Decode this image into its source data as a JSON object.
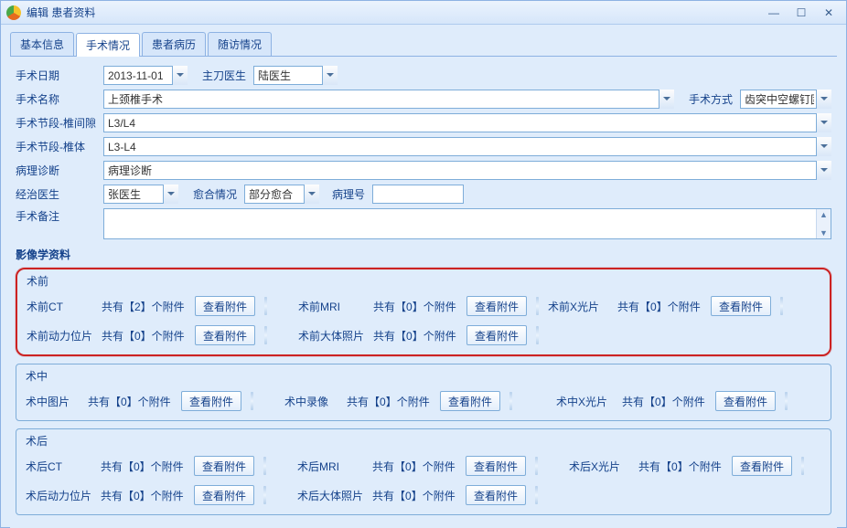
{
  "window": {
    "title": "编辑 患者资料"
  },
  "tabs": {
    "t0": "基本信息",
    "t1": "手术情况",
    "t2": "患者病历",
    "t3": "随访情况"
  },
  "form": {
    "date_label": "手术日期",
    "date_value": "2013-11-01",
    "surgeon_label": "主刀医生",
    "surgeon_value": "陆医生",
    "name_label": "手术名称",
    "name_value": "上颈椎手术",
    "method_label": "手术方式",
    "method_value": "齿突中空螺钉固定",
    "seg_gap_label": "手术节段-椎间隙",
    "seg_gap_value": "L3/L4",
    "seg_body_label": "手术节段-椎体",
    "seg_body_value": "L3-L4",
    "path_label": "病理诊断",
    "path_value": "病理诊断",
    "attending_label": "经治医生",
    "attending_value": "张医生",
    "healing_label": "愈合情况",
    "healing_value": "部分愈合",
    "pathno_label": "病理号",
    "pathno_value": "",
    "notes_label": "手术备注",
    "notes_value": ""
  },
  "imaging_heading": "影像学资料",
  "labels": {
    "view_attach": "查看附件",
    "count_prefix": "共有【",
    "count_suffix": "】个附件"
  },
  "groups": {
    "pre": {
      "title": "术前",
      "ct": {
        "label": "术前CT",
        "count": 2
      },
      "mri": {
        "label": "术前MRI",
        "count": 0
      },
      "xray": {
        "label": "术前X光片",
        "count": 0
      },
      "dyn": {
        "label": "术前动力位片",
        "count": 0
      },
      "gross": {
        "label": "术前大体照片",
        "count": 0
      }
    },
    "intra": {
      "title": "术中",
      "pic": {
        "label": "术中图片",
        "count": 0
      },
      "video": {
        "label": "术中录像",
        "count": 0
      },
      "xray": {
        "label": "术中X光片",
        "count": 0
      }
    },
    "post": {
      "title": "术后",
      "ct": {
        "label": "术后CT",
        "count": 0
      },
      "mri": {
        "label": "术后MRI",
        "count": 0
      },
      "xray": {
        "label": "术后X光片",
        "count": 0
      },
      "dyn": {
        "label": "术后动力位片",
        "count": 0
      },
      "gross": {
        "label": "术后大体照片",
        "count": 0
      }
    }
  }
}
